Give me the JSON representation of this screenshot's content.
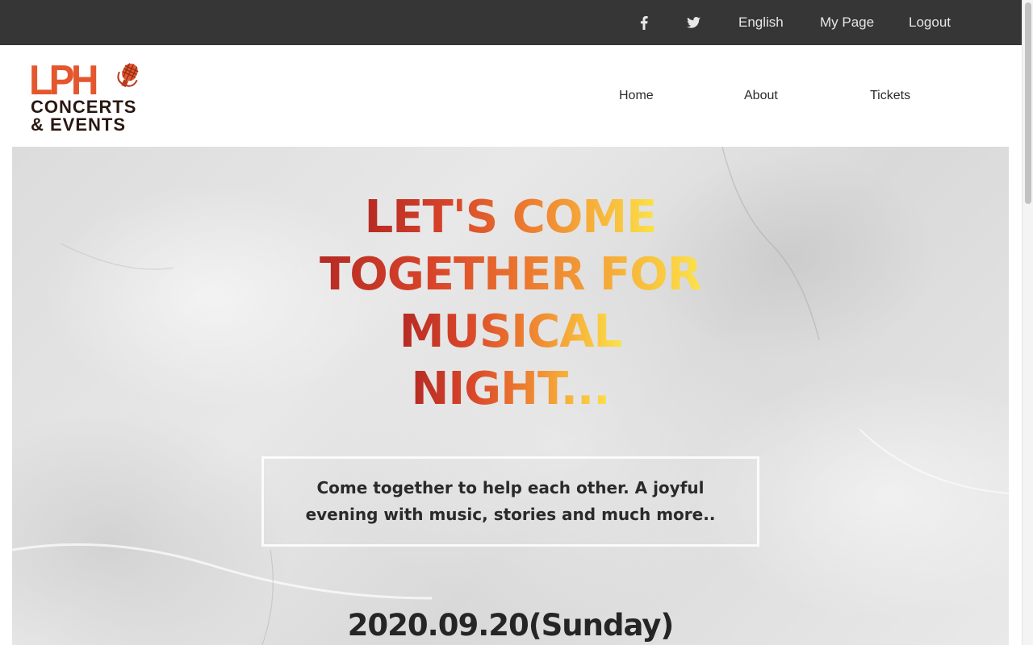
{
  "topbar": {
    "social": [
      {
        "icon": "facebook-icon"
      },
      {
        "icon": "twitter-icon"
      }
    ],
    "language": "English",
    "my_page": "My Page",
    "logout": "Logout"
  },
  "logo": {
    "mark": "LPH",
    "line1": "CONCERTS",
    "line2": "& EVENTS"
  },
  "nav": {
    "home": "Home",
    "about": "About",
    "tickets": "Tickets"
  },
  "hero": {
    "headline_lines": [
      "LET'S COME",
      "TOGETHER FOR",
      "MUSICAL",
      "NIGHT..."
    ],
    "tagline": "Come together to help each other. A joyful evening with music, stories and much more..",
    "date": "2020.09.20(Sunday)"
  },
  "colors": {
    "topbar_bg": "#363636",
    "brand": "#e4572e",
    "headline_gradient_start": "#b52a24",
    "headline_gradient_end": "#fbe24a"
  }
}
